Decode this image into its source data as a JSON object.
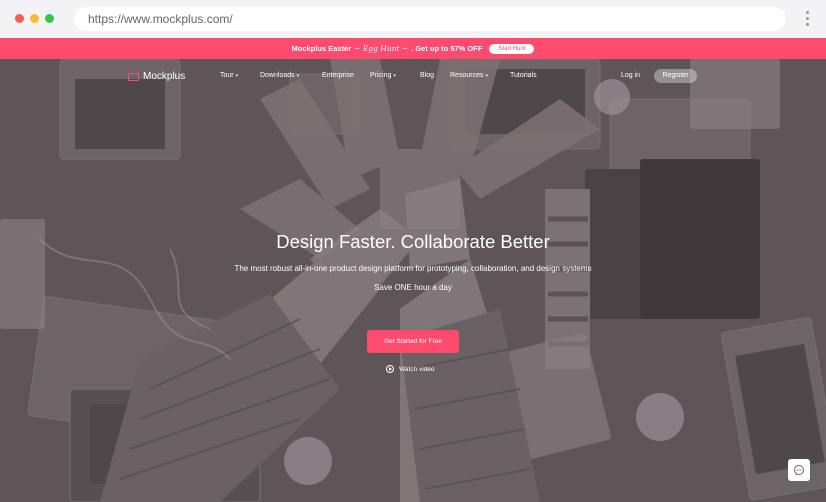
{
  "browser": {
    "url": "https://www.mockplus.com/"
  },
  "promo": {
    "text_before": "Mockplus Easter",
    "highlight": "~ Egg Hunt ~",
    "text_after": ". Get up to 57% OFF",
    "button_label": "Start Hunt"
  },
  "nav": {
    "brand": "Mockplus",
    "items": [
      {
        "label": "Tour",
        "dropdown": true
      },
      {
        "label": "Downloads",
        "dropdown": true
      },
      {
        "label": "Enterprise",
        "dropdown": false
      },
      {
        "label": "Pricing",
        "dropdown": true
      },
      {
        "label": "Blog",
        "dropdown": false
      },
      {
        "label": "Resources",
        "dropdown": true
      },
      {
        "label": "Tutorials",
        "dropdown": false
      }
    ],
    "login_label": "Log in",
    "register_label": "Register"
  },
  "hero": {
    "headline": "Design Faster. Collaborate Better",
    "subheadline": "The most robust all-in-one product design platform for prototyping, collaboration, and design systems",
    "tagline": "Save ONE hour a day",
    "cta_label": "Get Started for Free",
    "watch_label": "Watch video"
  },
  "colors": {
    "accent": "#fd4a6d",
    "overlay": "#5c5457"
  },
  "icons": {
    "chat": "chat-bubble-icon",
    "play": "play-circle-icon"
  }
}
